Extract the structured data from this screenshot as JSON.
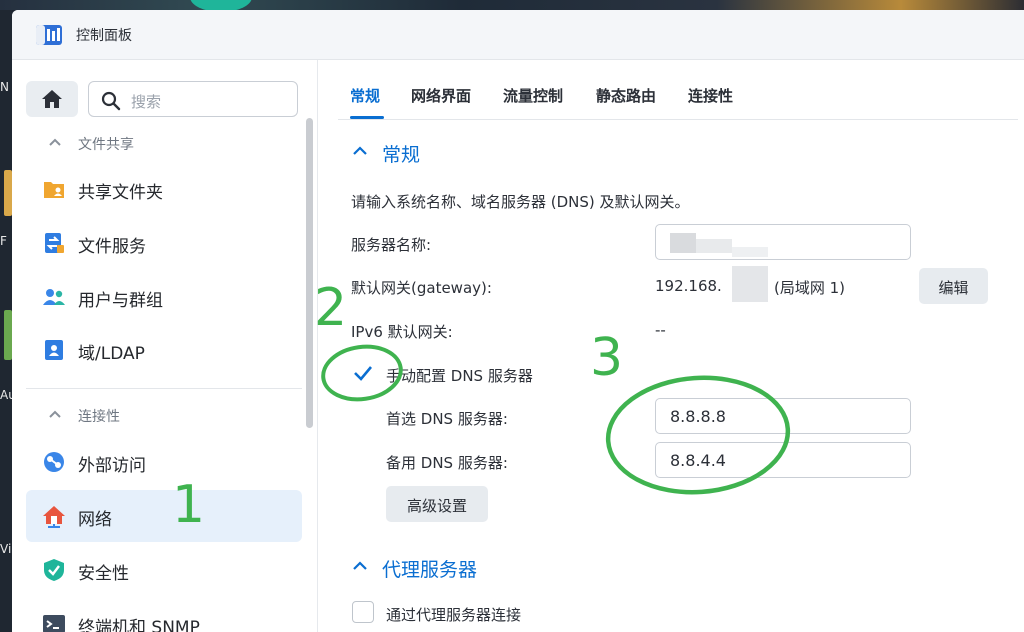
{
  "window": {
    "title": "控制面板"
  },
  "search": {
    "placeholder": "搜索"
  },
  "sidebar": {
    "sections": [
      {
        "label": "文件共享"
      },
      {
        "label": "连接性"
      }
    ],
    "items": [
      {
        "label": "共享文件夹",
        "icon": "shared-folder-icon"
      },
      {
        "label": "文件服务",
        "icon": "file-services-icon"
      },
      {
        "label": "用户与群组",
        "icon": "user-group-icon"
      },
      {
        "label": "域/LDAP",
        "icon": "domain-ldap-icon"
      },
      {
        "label": "外部访问",
        "icon": "external-access-icon"
      },
      {
        "label": "网络",
        "icon": "network-icon",
        "active": true
      },
      {
        "label": "安全性",
        "icon": "security-shield-icon"
      },
      {
        "label": "终端机和 SNMP",
        "icon": "terminal-icon"
      }
    ]
  },
  "tabs": [
    {
      "label": "常规",
      "active": true
    },
    {
      "label": "网络界面"
    },
    {
      "label": "流量控制"
    },
    {
      "label": "静态路由"
    },
    {
      "label": "连接性"
    }
  ],
  "general": {
    "heading": "常规",
    "description": "请输入系统名称、域名服务器 (DNS) 及默认网关。",
    "server_name_label": "服务器名称:",
    "gateway_label": "默认网关(gateway):",
    "gateway_value_prefix": "192.168.",
    "gateway_value_suffix": "(局域网 1)",
    "edit_button": "编辑",
    "ipv6_label": "IPv6 默认网关:",
    "ipv6_value": "--",
    "manual_dns_label": "手动配置 DNS 服务器",
    "manual_dns_checked": true,
    "preferred_dns_label": "首选 DNS 服务器:",
    "preferred_dns_value": "8.8.8.8",
    "alternate_dns_label": "备用 DNS 服务器:",
    "alternate_dns_value": "8.8.4.4",
    "advanced_button": "高级设置"
  },
  "proxy": {
    "heading": "代理服务器",
    "connect_via_proxy_label": "通过代理服务器连接",
    "connect_via_proxy_checked": false
  },
  "annotations": {
    "n1": "1",
    "n2": "2",
    "n3": "3"
  },
  "desktop": {
    "letters": [
      "N",
      "F",
      "Au",
      "Vi"
    ]
  },
  "colors": {
    "accent": "#0a6ed1",
    "annotation": "#3fb34f",
    "active_item_bg": "#e6f0fb"
  }
}
